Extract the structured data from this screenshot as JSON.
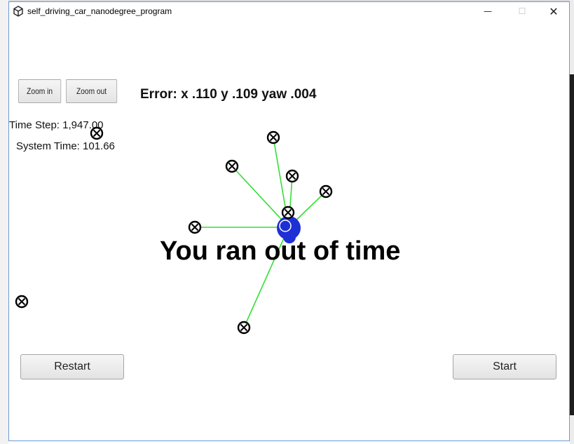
{
  "window": {
    "title": "self_driving_car_nanodegree_program",
    "controls": {
      "minimize": "—",
      "maximize": "☐",
      "close": "✕"
    }
  },
  "toolbar": {
    "zoom_in_label": "Zoom in",
    "zoom_out_label": "Zoom out"
  },
  "hud": {
    "error": "Error: x .110 y .109 yaw .004",
    "time_step": "Time Step: 1,947.00",
    "system_time": "System Time: 101.66"
  },
  "message": "You ran out of time",
  "buttons": {
    "restart_label": "Restart",
    "start_label": "Start"
  },
  "colors": {
    "observation_line": "#33e033",
    "vehicle": "#1f2fd6",
    "landmark": "#000000",
    "window_border": "#6f9ad6"
  },
  "icons": {
    "app": "unity-icon",
    "landmark": "circled-x-icon"
  }
}
